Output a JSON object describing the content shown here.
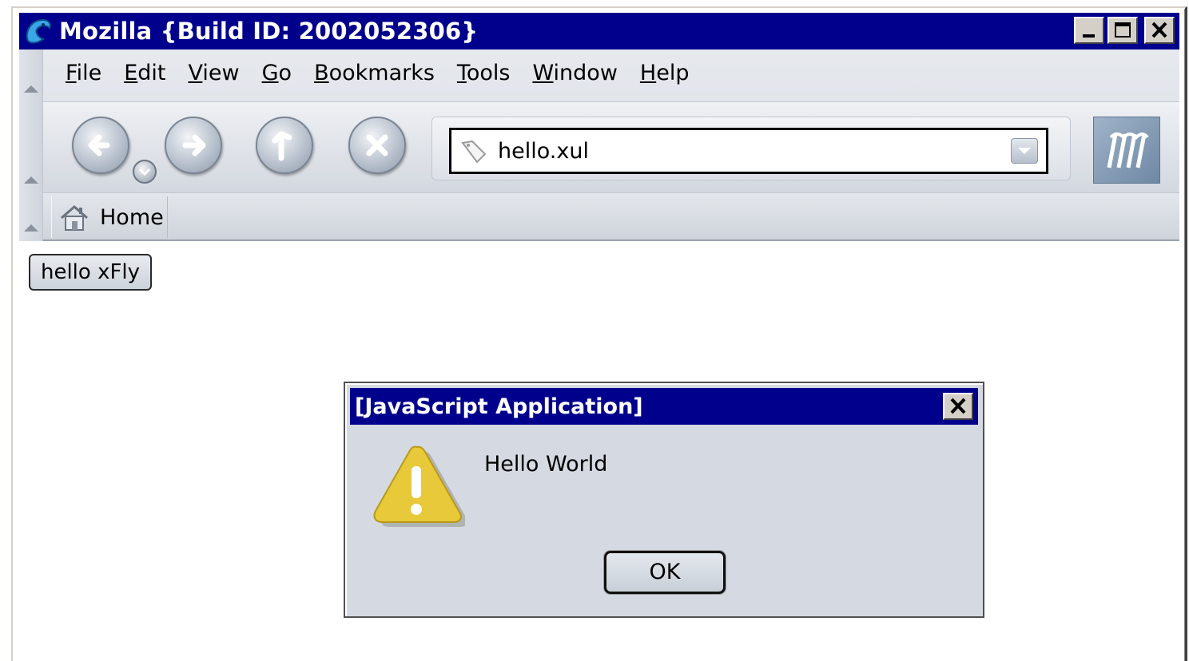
{
  "window": {
    "title": "Mozilla {Build ID: 2002052306}"
  },
  "menubar": {
    "items": [
      {
        "accel": "F",
        "rest": "ile"
      },
      {
        "accel": "E",
        "rest": "dit"
      },
      {
        "accel": "V",
        "rest": "iew"
      },
      {
        "accel": "G",
        "rest": "o"
      },
      {
        "accel": "B",
        "rest": "ookmarks"
      },
      {
        "accel": "T",
        "rest": "ools"
      },
      {
        "accel": "W",
        "rest": "indow"
      },
      {
        "accel": "H",
        "rest": "elp"
      }
    ]
  },
  "navbar": {
    "buttons": [
      "back-icon",
      "forward-icon",
      "reload-icon",
      "stop-icon"
    ],
    "url": "hello.xul"
  },
  "personalbar": {
    "home_label": "Home"
  },
  "content": {
    "button_label": "hello xFly"
  },
  "dialog": {
    "title": "[JavaScript Application]",
    "message": "Hello World",
    "ok_label": "OK",
    "icon": "warning-icon"
  },
  "colors": {
    "titlebar": "#00008c",
    "chrome": "#dfe3e9",
    "dialog_bg": "#d5dae2"
  }
}
